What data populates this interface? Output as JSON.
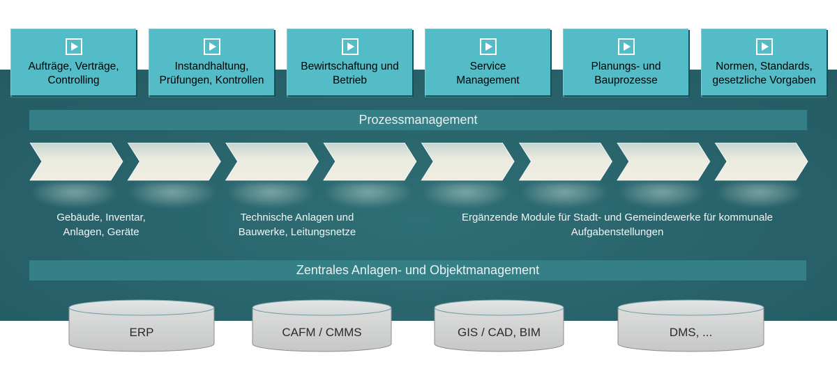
{
  "top_boxes": [
    {
      "icon": "play-icon",
      "label_line1": "Aufträge, Verträge,",
      "label_line2": "Controlling"
    },
    {
      "icon": "play-icon",
      "label_line1": "Instandhaltung,",
      "label_line2": "Prüfungen, Kontrollen"
    },
    {
      "icon": "play-icon",
      "label_line1": "Bewirtschaftung und",
      "label_line2": "Betrieb"
    },
    {
      "icon": "play-icon",
      "label_line1": "Service",
      "label_line2": "Management"
    },
    {
      "icon": "play-icon",
      "label_line1": "Planungs- und",
      "label_line2": "Bauprozesse"
    },
    {
      "icon": "play-icon",
      "label_line1": "Normen, Standards,",
      "label_line2": "gesetzliche Vorgaben"
    }
  ],
  "process_bar": {
    "label": "Prozessmanagement"
  },
  "chevron_count": 8,
  "descriptions": [
    {
      "line1": "Gebäude, Inventar,",
      "line2": "Anlagen, Geräte"
    },
    {
      "line1": "Technische Anlagen und",
      "line2": "Bauwerke, Leitungsnetze"
    },
    {
      "line1": "Ergänzende Module für Stadt- und Gemeindewerke für kommunale",
      "line2": "Aufgabenstellungen"
    }
  ],
  "object_bar": {
    "label": "Zentrales Anlagen- und Objektmanagement"
  },
  "databases": [
    {
      "label": "ERP"
    },
    {
      "label": "CAFM / CMMS"
    },
    {
      "label": "GIS / CAD, BIM"
    },
    {
      "label": "DMS, ..."
    }
  ],
  "colors": {
    "band": "#28616a",
    "top_box": "#54bcc7",
    "bar": "#357f86",
    "chevron": "#eeede2",
    "cylinder": "#d2d4d4"
  }
}
